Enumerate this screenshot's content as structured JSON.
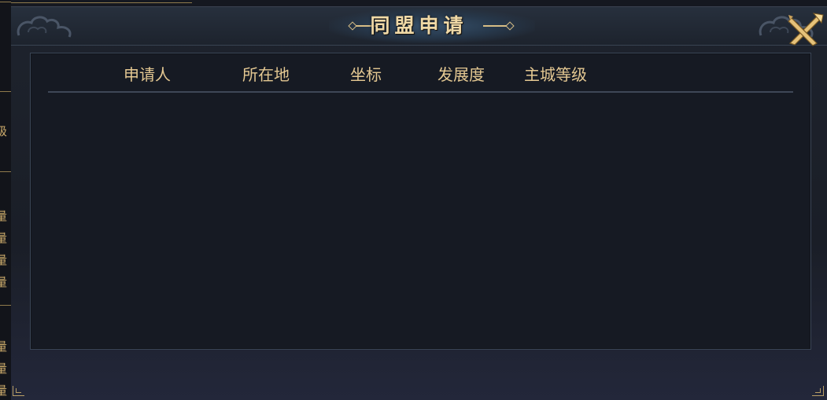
{
  "dialog": {
    "title": "同盟申请"
  },
  "table": {
    "columns": [
      "申请人",
      "所在地",
      "坐标",
      "发展度",
      "主城等级"
    ],
    "rows": []
  },
  "background": {
    "left_fragments": [
      ":",
      "级",
      "量",
      "量",
      "量",
      "量",
      "量",
      "量",
      "量"
    ]
  },
  "colors": {
    "gold_text": "#e4c892",
    "title_text": "#f0d9a6",
    "panel_bg": "#161a23",
    "frame_border": "#3a4556"
  },
  "icons": {
    "close": "crossed-swords-close-icon"
  }
}
